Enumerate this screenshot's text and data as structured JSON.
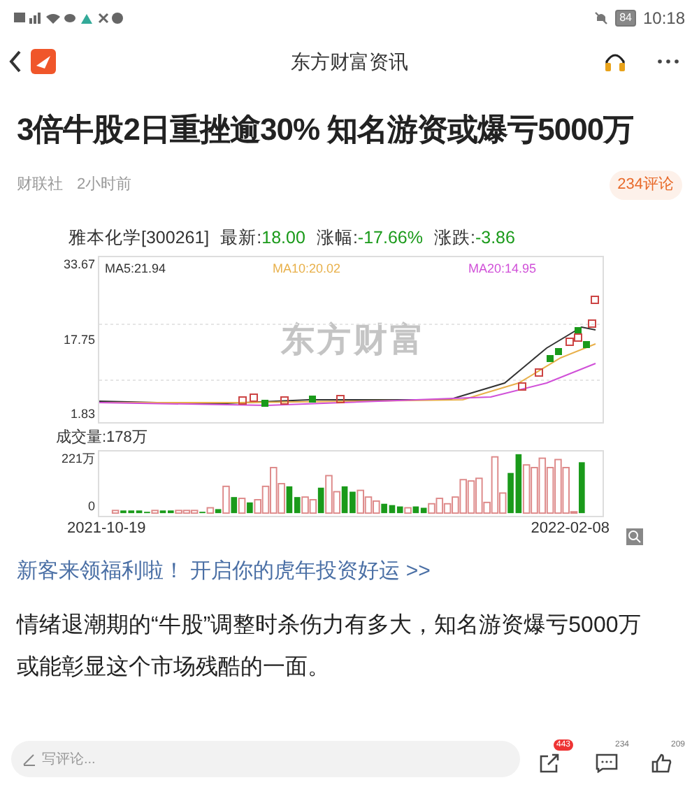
{
  "status_bar": {
    "battery": "84",
    "time": "10:18"
  },
  "header": {
    "title": "东方财富资讯"
  },
  "article": {
    "title": "3倍牛股2日重挫逾30% 知名游资或爆亏5000万",
    "source": "财联社",
    "time": "2小时前",
    "comments_badge": "234评论"
  },
  "chart": {
    "stock": "雅本化学[300261]",
    "latest_label": "最新:",
    "latest": "18.00",
    "change_pct_label": "涨幅:",
    "change_pct": "-17.66%",
    "change_label": "涨跌:",
    "change": "-3.86",
    "ma": [
      {
        "label": "MA5:21.94",
        "color": "#333333"
      },
      {
        "label": "MA10:20.02",
        "color": "#e8b04a"
      },
      {
        "label": "MA20:14.95",
        "color": "#d050d8"
      }
    ],
    "price_ticks": [
      "33.67",
      "17.75",
      "1.83"
    ],
    "watermark": "东方财富",
    "volume_label": "成交量:178万",
    "volume_ticks": [
      "221万",
      "0"
    ],
    "start_date": "2021-10-19",
    "end_date": "2022-02-08"
  },
  "promo_link": "新客来领福利啦！ 开启你的虎年投资好运 >>",
  "paragraph": "情绪退潮期的“牛股”调整时杀伤力有多大，知名游资爆亏5000万或能彰显这个市场残酷的一面。",
  "bottom_bar": {
    "comment_placeholder": "写评论...",
    "share_count": "443",
    "comment_count": "234",
    "like_count": "209"
  }
}
